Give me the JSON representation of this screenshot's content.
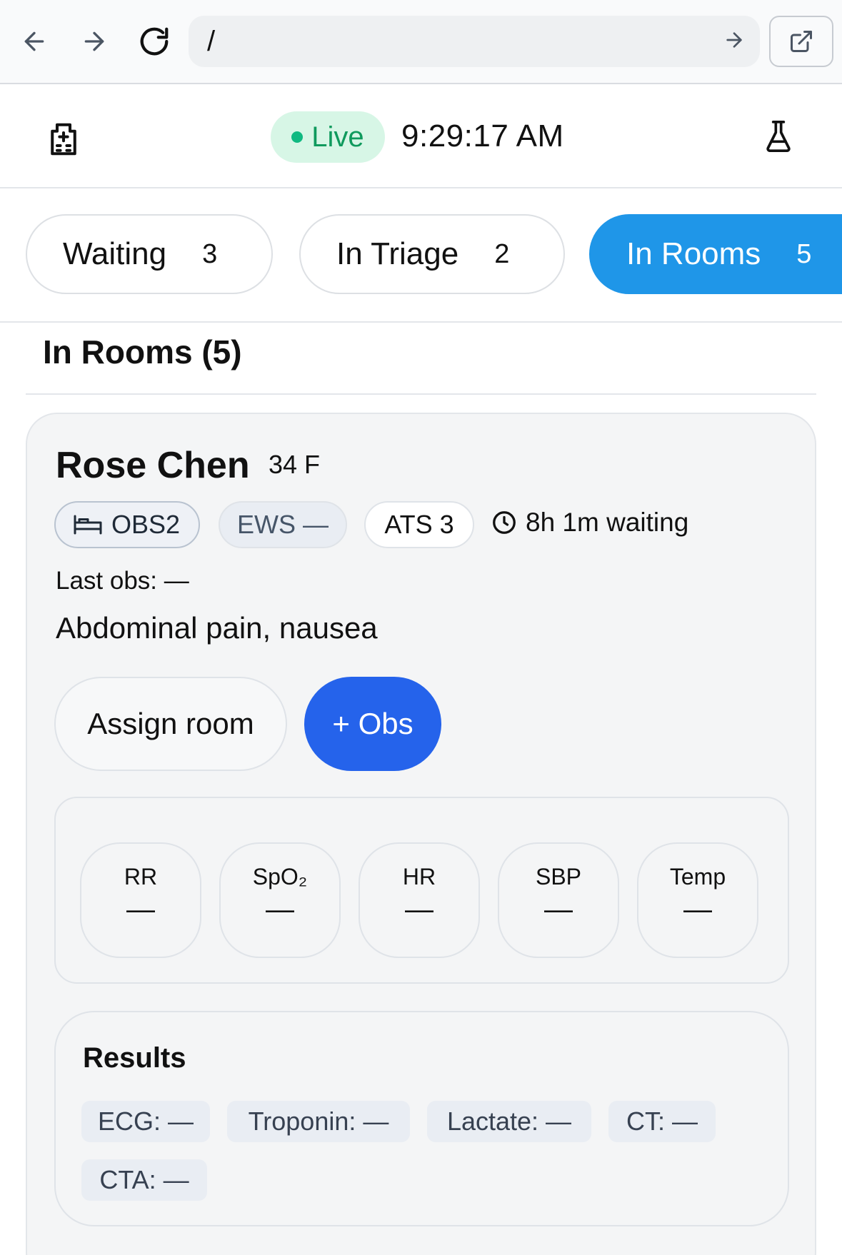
{
  "browser": {
    "url": "/"
  },
  "header": {
    "live_label": "Live",
    "time": "9:29:17 AM",
    "live_color": "#10b981"
  },
  "tabs": [
    {
      "label": "Waiting",
      "count": "3",
      "active": false
    },
    {
      "label": "In Triage",
      "count": "2",
      "active": false
    },
    {
      "label": "In Rooms",
      "count": "5",
      "active": true
    }
  ],
  "section": {
    "title": "In Rooms (5)"
  },
  "patient": {
    "name": "Rose Chen",
    "meta": "34 F",
    "bed": "OBS2",
    "ews": "EWS —",
    "ats": "ATS 3",
    "waiting": "8h 1m waiting",
    "last_obs": "Last obs: —",
    "complaint": "Abdominal pain, nausea",
    "assign_label": "Assign room",
    "obs_label": "+ Obs"
  },
  "vitals": [
    {
      "label": "RR",
      "value": "—"
    },
    {
      "label": "SpO₂",
      "value": "—"
    },
    {
      "label": "HR",
      "value": "—"
    },
    {
      "label": "SBP",
      "value": "—"
    },
    {
      "label": "Temp",
      "value": "—"
    }
  ],
  "results": {
    "title": "Results",
    "items": [
      "ECG: —",
      "Troponin: —",
      "Lactate: —",
      "CT: —",
      "CTA: —"
    ]
  },
  "colors": {
    "active_tab": "#1f96e8",
    "primary_button": "#2563eb"
  }
}
